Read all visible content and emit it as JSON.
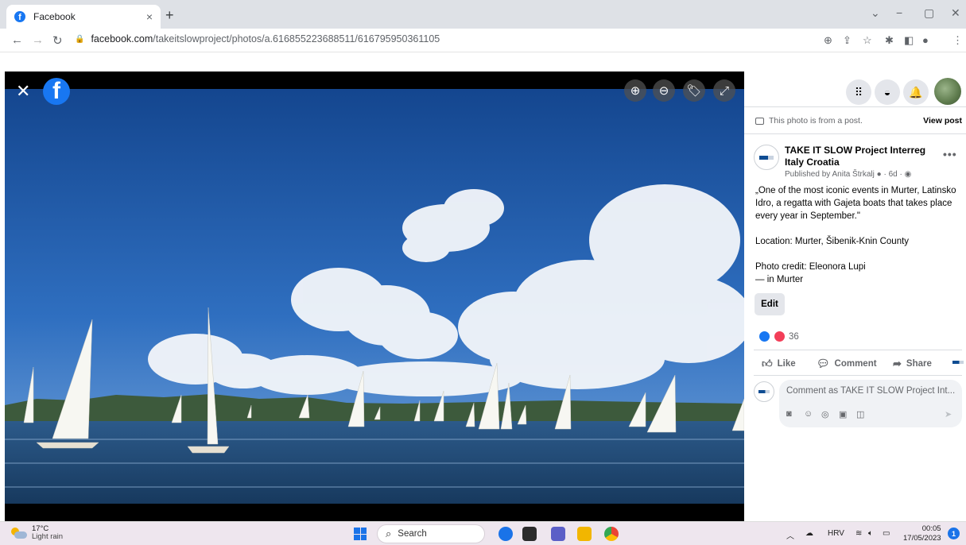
{
  "browser": {
    "tab_title": "Facebook",
    "tab_close": "×",
    "new_tab": "+",
    "url_host": "facebook.com",
    "url_path": "/takeitslowproject/photos/a.616855223688511/616795950361105",
    "window_controls": [
      "⌄",
      "−",
      "▢",
      "✕"
    ]
  },
  "viewer": {
    "close_label": "✕",
    "logo_letter": "f",
    "controls": [
      "zoom-in-icon",
      "zoom-out-icon",
      "tag-icon",
      "fullscreen-icon"
    ]
  },
  "panel": {
    "from_post_text": "This photo is from a post.",
    "view_post_label": "View post",
    "page_name": "TAKE IT SLOW Project Interreg Italy Croatia",
    "published_by": "Published by Anita Štrkalj",
    "time_ago": "6d",
    "post_paragraph_1": "„One of the most iconic events in Murter, Latinsko Idro, a regatta with Gajeta boats that takes place every year in September.\"",
    "location_line": "Location: Murter, Šibenik-Knin County",
    "photo_credit": "Photo credit: Eleonora Lupi",
    "in_prefix": "— in ",
    "in_place": "Murter",
    "edit_label": "Edit",
    "reaction_count": "36",
    "like_label": "Like",
    "comment_label": "Comment",
    "share_label": "Share",
    "comment_placeholder": "Comment as TAKE IT SLOW Project Int..."
  },
  "taskbar": {
    "temperature": "17°C",
    "weather_desc": "Light rain",
    "search_label": "Search",
    "language": "HRV",
    "time": "00:05",
    "date": "17/05/2023",
    "notification_count": "1"
  }
}
